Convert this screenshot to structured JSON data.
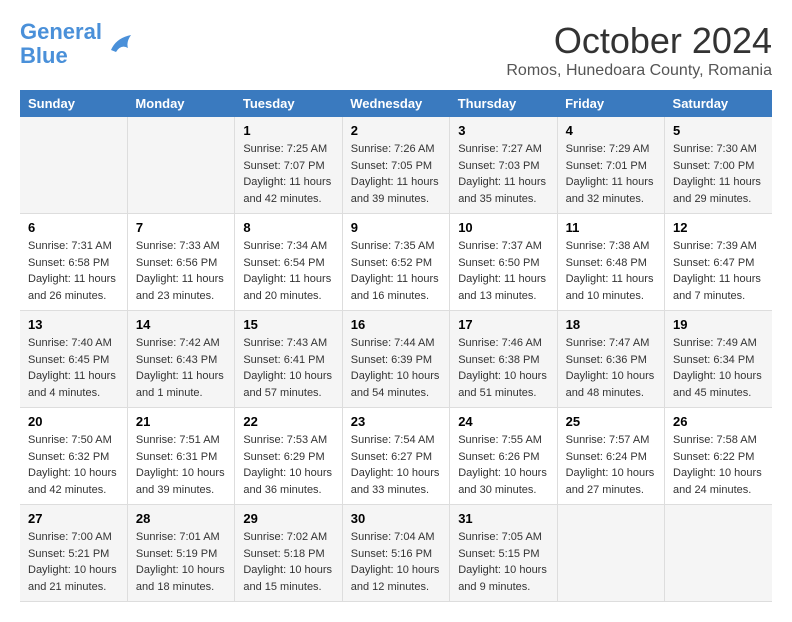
{
  "header": {
    "logo_line1": "General",
    "logo_line2": "Blue",
    "month": "October 2024",
    "location": "Romos, Hunedoara County, Romania"
  },
  "weekdays": [
    "Sunday",
    "Monday",
    "Tuesday",
    "Wednesday",
    "Thursday",
    "Friday",
    "Saturday"
  ],
  "weeks": [
    [
      {
        "day": "",
        "info": ""
      },
      {
        "day": "",
        "info": ""
      },
      {
        "day": "1",
        "sunrise": "Sunrise: 7:25 AM",
        "sunset": "Sunset: 7:07 PM",
        "daylight": "Daylight: 11 hours and 42 minutes."
      },
      {
        "day": "2",
        "sunrise": "Sunrise: 7:26 AM",
        "sunset": "Sunset: 7:05 PM",
        "daylight": "Daylight: 11 hours and 39 minutes."
      },
      {
        "day": "3",
        "sunrise": "Sunrise: 7:27 AM",
        "sunset": "Sunset: 7:03 PM",
        "daylight": "Daylight: 11 hours and 35 minutes."
      },
      {
        "day": "4",
        "sunrise": "Sunrise: 7:29 AM",
        "sunset": "Sunset: 7:01 PM",
        "daylight": "Daylight: 11 hours and 32 minutes."
      },
      {
        "day": "5",
        "sunrise": "Sunrise: 7:30 AM",
        "sunset": "Sunset: 7:00 PM",
        "daylight": "Daylight: 11 hours and 29 minutes."
      }
    ],
    [
      {
        "day": "6",
        "sunrise": "Sunrise: 7:31 AM",
        "sunset": "Sunset: 6:58 PM",
        "daylight": "Daylight: 11 hours and 26 minutes."
      },
      {
        "day": "7",
        "sunrise": "Sunrise: 7:33 AM",
        "sunset": "Sunset: 6:56 PM",
        "daylight": "Daylight: 11 hours and 23 minutes."
      },
      {
        "day": "8",
        "sunrise": "Sunrise: 7:34 AM",
        "sunset": "Sunset: 6:54 PM",
        "daylight": "Daylight: 11 hours and 20 minutes."
      },
      {
        "day": "9",
        "sunrise": "Sunrise: 7:35 AM",
        "sunset": "Sunset: 6:52 PM",
        "daylight": "Daylight: 11 hours and 16 minutes."
      },
      {
        "day": "10",
        "sunrise": "Sunrise: 7:37 AM",
        "sunset": "Sunset: 6:50 PM",
        "daylight": "Daylight: 11 hours and 13 minutes."
      },
      {
        "day": "11",
        "sunrise": "Sunrise: 7:38 AM",
        "sunset": "Sunset: 6:48 PM",
        "daylight": "Daylight: 11 hours and 10 minutes."
      },
      {
        "day": "12",
        "sunrise": "Sunrise: 7:39 AM",
        "sunset": "Sunset: 6:47 PM",
        "daylight": "Daylight: 11 hours and 7 minutes."
      }
    ],
    [
      {
        "day": "13",
        "sunrise": "Sunrise: 7:40 AM",
        "sunset": "Sunset: 6:45 PM",
        "daylight": "Daylight: 11 hours and 4 minutes."
      },
      {
        "day": "14",
        "sunrise": "Sunrise: 7:42 AM",
        "sunset": "Sunset: 6:43 PM",
        "daylight": "Daylight: 11 hours and 1 minute."
      },
      {
        "day": "15",
        "sunrise": "Sunrise: 7:43 AM",
        "sunset": "Sunset: 6:41 PM",
        "daylight": "Daylight: 10 hours and 57 minutes."
      },
      {
        "day": "16",
        "sunrise": "Sunrise: 7:44 AM",
        "sunset": "Sunset: 6:39 PM",
        "daylight": "Daylight: 10 hours and 54 minutes."
      },
      {
        "day": "17",
        "sunrise": "Sunrise: 7:46 AM",
        "sunset": "Sunset: 6:38 PM",
        "daylight": "Daylight: 10 hours and 51 minutes."
      },
      {
        "day": "18",
        "sunrise": "Sunrise: 7:47 AM",
        "sunset": "Sunset: 6:36 PM",
        "daylight": "Daylight: 10 hours and 48 minutes."
      },
      {
        "day": "19",
        "sunrise": "Sunrise: 7:49 AM",
        "sunset": "Sunset: 6:34 PM",
        "daylight": "Daylight: 10 hours and 45 minutes."
      }
    ],
    [
      {
        "day": "20",
        "sunrise": "Sunrise: 7:50 AM",
        "sunset": "Sunset: 6:32 PM",
        "daylight": "Daylight: 10 hours and 42 minutes."
      },
      {
        "day": "21",
        "sunrise": "Sunrise: 7:51 AM",
        "sunset": "Sunset: 6:31 PM",
        "daylight": "Daylight: 10 hours and 39 minutes."
      },
      {
        "day": "22",
        "sunrise": "Sunrise: 7:53 AM",
        "sunset": "Sunset: 6:29 PM",
        "daylight": "Daylight: 10 hours and 36 minutes."
      },
      {
        "day": "23",
        "sunrise": "Sunrise: 7:54 AM",
        "sunset": "Sunset: 6:27 PM",
        "daylight": "Daylight: 10 hours and 33 minutes."
      },
      {
        "day": "24",
        "sunrise": "Sunrise: 7:55 AM",
        "sunset": "Sunset: 6:26 PM",
        "daylight": "Daylight: 10 hours and 30 minutes."
      },
      {
        "day": "25",
        "sunrise": "Sunrise: 7:57 AM",
        "sunset": "Sunset: 6:24 PM",
        "daylight": "Daylight: 10 hours and 27 minutes."
      },
      {
        "day": "26",
        "sunrise": "Sunrise: 7:58 AM",
        "sunset": "Sunset: 6:22 PM",
        "daylight": "Daylight: 10 hours and 24 minutes."
      }
    ],
    [
      {
        "day": "27",
        "sunrise": "Sunrise: 7:00 AM",
        "sunset": "Sunset: 5:21 PM",
        "daylight": "Daylight: 10 hours and 21 minutes."
      },
      {
        "day": "28",
        "sunrise": "Sunrise: 7:01 AM",
        "sunset": "Sunset: 5:19 PM",
        "daylight": "Daylight: 10 hours and 18 minutes."
      },
      {
        "day": "29",
        "sunrise": "Sunrise: 7:02 AM",
        "sunset": "Sunset: 5:18 PM",
        "daylight": "Daylight: 10 hours and 15 minutes."
      },
      {
        "day": "30",
        "sunrise": "Sunrise: 7:04 AM",
        "sunset": "Sunset: 5:16 PM",
        "daylight": "Daylight: 10 hours and 12 minutes."
      },
      {
        "day": "31",
        "sunrise": "Sunrise: 7:05 AM",
        "sunset": "Sunset: 5:15 PM",
        "daylight": "Daylight: 10 hours and 9 minutes."
      },
      {
        "day": "",
        "info": ""
      },
      {
        "day": "",
        "info": ""
      }
    ]
  ]
}
